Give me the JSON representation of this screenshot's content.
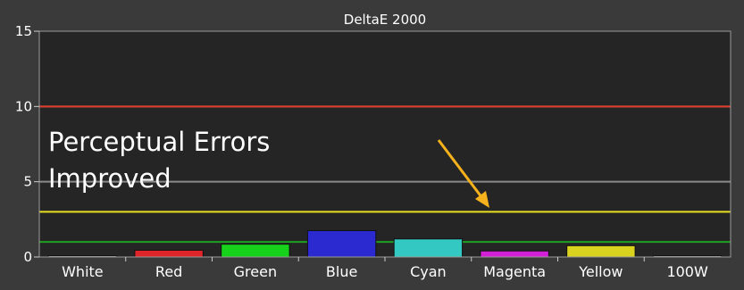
{
  "chart_data": {
    "type": "bar",
    "title": "DeltaE 2000",
    "xlabel": "",
    "ylabel": "",
    "ylim": [
      0,
      15
    ],
    "yticks": [
      0,
      5,
      10,
      15
    ],
    "categories": [
      "White",
      "Red",
      "Green",
      "Blue",
      "Cyan",
      "Magenta",
      "Yellow",
      "100W"
    ],
    "values": [
      0.08,
      0.45,
      0.85,
      1.75,
      1.2,
      0.4,
      0.75,
      0.08
    ],
    "bar_colors": [
      "#cfcfcf",
      "#e0252a",
      "#17d21a",
      "#2a2ad0",
      "#33c9c2",
      "#d120d6",
      "#d9d21e",
      "#cfcfcf"
    ],
    "reference_lines": [
      {
        "value": 10,
        "color": "#e23a2a"
      },
      {
        "value": 3,
        "color": "#e8e020"
      },
      {
        "value": 1,
        "color": "#1fa01f"
      }
    ],
    "grid": true,
    "annotation": {
      "lines": [
        "Perceptual Errors",
        "Improved"
      ],
      "arrow_color": "#f6b21c"
    },
    "colors": {
      "background": "#3a3a3a",
      "plot_background": "#252525",
      "gridline": "#8a8a8a"
    }
  }
}
